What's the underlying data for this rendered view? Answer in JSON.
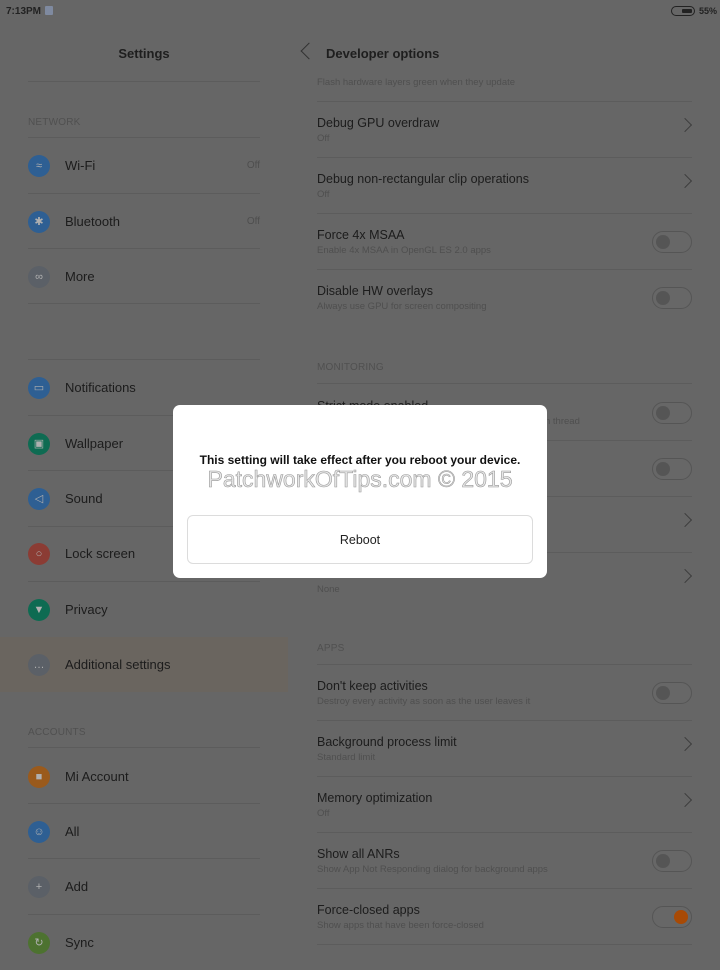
{
  "status_bar": {
    "time": "7:13PM",
    "battery": "55%",
    "battery_level": 55
  },
  "left": {
    "title": "Settings",
    "sections": {
      "network": "NETWORK",
      "accounts": "ACCOUNTS"
    },
    "items": [
      {
        "label": "Wi-Fi",
        "value": "Off",
        "icon": "wifi-icon",
        "color": "#2e5f93"
      },
      {
        "label": "Bluetooth",
        "value": "Off",
        "icon": "bluetooth-icon",
        "color": "#2e5f93"
      },
      {
        "label": "More",
        "icon": "link-icon",
        "color": "#5b6067"
      },
      {
        "label": "Notifications",
        "icon": "notifications-icon",
        "color": "#2e5f93"
      },
      {
        "label": "Wallpaper",
        "icon": "wallpaper-icon",
        "color": "#0e6b52"
      },
      {
        "label": "Sound",
        "icon": "sound-icon",
        "color": "#2e5f93"
      },
      {
        "label": "Lock screen",
        "icon": "lock-icon",
        "color": "#8b3c34"
      },
      {
        "label": "Privacy",
        "icon": "shield-icon",
        "color": "#0e6b52"
      },
      {
        "label": "Additional settings",
        "icon": "more-dots-icon",
        "color": "#5b6067",
        "selected": true
      },
      {
        "label": "Mi Account",
        "icon": "mi-account-icon",
        "color": "#9a5a1c"
      },
      {
        "label": "All",
        "icon": "user-icon",
        "color": "#2e5f93"
      },
      {
        "label": "Add",
        "icon": "plus-icon",
        "color": "#5b6067"
      },
      {
        "label": "Sync",
        "icon": "sync-icon",
        "color": "#4d7230"
      }
    ]
  },
  "right": {
    "title": "Developer options",
    "sections": {
      "monitoring": "MONITORING",
      "apps": "APPS"
    },
    "items": [
      {
        "subtitle": "Flash hardware layers green when they update"
      },
      {
        "title": "Debug GPU overdraw",
        "subtitle": "Off",
        "control": "chevron"
      },
      {
        "title": "Debug non-rectangular clip operations",
        "subtitle": "Off",
        "control": "chevron"
      },
      {
        "title": "Force 4x MSAA",
        "subtitle": "Enable 4x MSAA in OpenGL ES 2.0 apps",
        "control": "toggle",
        "on": false
      },
      {
        "title": "Disable HW overlays",
        "subtitle": "Always use GPU for screen compositing",
        "control": "toggle",
        "on": false
      },
      {
        "title": "Strict mode enabled",
        "subtitle": "n thread",
        "control": "toggle",
        "on": false
      },
      {
        "control": "toggle",
        "on": false
      },
      {
        "control": "chevron"
      },
      {
        "subtitle": "None",
        "control": "chevron"
      },
      {
        "title": "Don't keep activities",
        "subtitle": "Destroy every activity as soon as the user leaves it",
        "control": "toggle",
        "on": false
      },
      {
        "title": "Background process limit",
        "subtitle": "Standard limit",
        "control": "chevron"
      },
      {
        "title": "Memory optimization",
        "subtitle": "Off",
        "control": "chevron"
      },
      {
        "title": "Show all ANRs",
        "subtitle": "Show App Not Responding dialog for background apps",
        "control": "toggle",
        "on": false
      },
      {
        "title": "Force-closed apps",
        "subtitle": "Show apps that have been force-closed",
        "control": "toggle",
        "on": true
      }
    ]
  },
  "dialog": {
    "message": "This setting will take effect after you reboot your device.",
    "watermark": "PatchworkOfTips.com © 2015",
    "button": "Reboot"
  }
}
